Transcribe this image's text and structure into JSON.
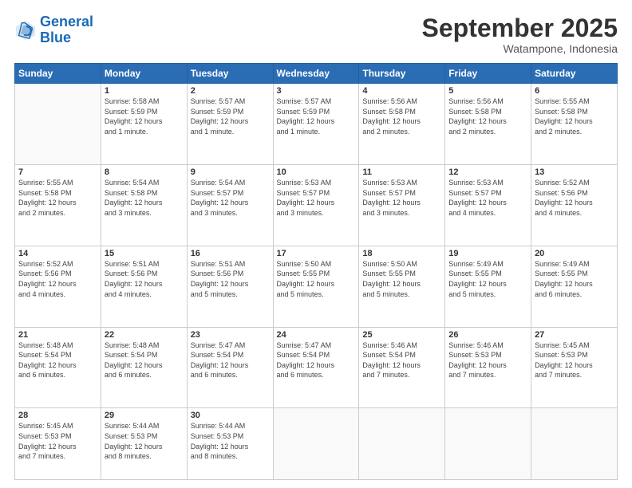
{
  "logo": {
    "line1": "General",
    "line2": "Blue"
  },
  "header": {
    "month": "September 2025",
    "location": "Watampone, Indonesia"
  },
  "weekdays": [
    "Sunday",
    "Monday",
    "Tuesday",
    "Wednesday",
    "Thursday",
    "Friday",
    "Saturday"
  ],
  "weeks": [
    [
      {
        "day": "",
        "info": ""
      },
      {
        "day": "1",
        "info": "Sunrise: 5:58 AM\nSunset: 5:59 PM\nDaylight: 12 hours\nand 1 minute."
      },
      {
        "day": "2",
        "info": "Sunrise: 5:57 AM\nSunset: 5:59 PM\nDaylight: 12 hours\nand 1 minute."
      },
      {
        "day": "3",
        "info": "Sunrise: 5:57 AM\nSunset: 5:59 PM\nDaylight: 12 hours\nand 1 minute."
      },
      {
        "day": "4",
        "info": "Sunrise: 5:56 AM\nSunset: 5:58 PM\nDaylight: 12 hours\nand 2 minutes."
      },
      {
        "day": "5",
        "info": "Sunrise: 5:56 AM\nSunset: 5:58 PM\nDaylight: 12 hours\nand 2 minutes."
      },
      {
        "day": "6",
        "info": "Sunrise: 5:55 AM\nSunset: 5:58 PM\nDaylight: 12 hours\nand 2 minutes."
      }
    ],
    [
      {
        "day": "7",
        "info": "Sunrise: 5:55 AM\nSunset: 5:58 PM\nDaylight: 12 hours\nand 2 minutes."
      },
      {
        "day": "8",
        "info": "Sunrise: 5:54 AM\nSunset: 5:58 PM\nDaylight: 12 hours\nand 3 minutes."
      },
      {
        "day": "9",
        "info": "Sunrise: 5:54 AM\nSunset: 5:57 PM\nDaylight: 12 hours\nand 3 minutes."
      },
      {
        "day": "10",
        "info": "Sunrise: 5:53 AM\nSunset: 5:57 PM\nDaylight: 12 hours\nand 3 minutes."
      },
      {
        "day": "11",
        "info": "Sunrise: 5:53 AM\nSunset: 5:57 PM\nDaylight: 12 hours\nand 3 minutes."
      },
      {
        "day": "12",
        "info": "Sunrise: 5:53 AM\nSunset: 5:57 PM\nDaylight: 12 hours\nand 4 minutes."
      },
      {
        "day": "13",
        "info": "Sunrise: 5:52 AM\nSunset: 5:56 PM\nDaylight: 12 hours\nand 4 minutes."
      }
    ],
    [
      {
        "day": "14",
        "info": "Sunrise: 5:52 AM\nSunset: 5:56 PM\nDaylight: 12 hours\nand 4 minutes."
      },
      {
        "day": "15",
        "info": "Sunrise: 5:51 AM\nSunset: 5:56 PM\nDaylight: 12 hours\nand 4 minutes."
      },
      {
        "day": "16",
        "info": "Sunrise: 5:51 AM\nSunset: 5:56 PM\nDaylight: 12 hours\nand 5 minutes."
      },
      {
        "day": "17",
        "info": "Sunrise: 5:50 AM\nSunset: 5:55 PM\nDaylight: 12 hours\nand 5 minutes."
      },
      {
        "day": "18",
        "info": "Sunrise: 5:50 AM\nSunset: 5:55 PM\nDaylight: 12 hours\nand 5 minutes."
      },
      {
        "day": "19",
        "info": "Sunrise: 5:49 AM\nSunset: 5:55 PM\nDaylight: 12 hours\nand 5 minutes."
      },
      {
        "day": "20",
        "info": "Sunrise: 5:49 AM\nSunset: 5:55 PM\nDaylight: 12 hours\nand 6 minutes."
      }
    ],
    [
      {
        "day": "21",
        "info": "Sunrise: 5:48 AM\nSunset: 5:54 PM\nDaylight: 12 hours\nand 6 minutes."
      },
      {
        "day": "22",
        "info": "Sunrise: 5:48 AM\nSunset: 5:54 PM\nDaylight: 12 hours\nand 6 minutes."
      },
      {
        "day": "23",
        "info": "Sunrise: 5:47 AM\nSunset: 5:54 PM\nDaylight: 12 hours\nand 6 minutes."
      },
      {
        "day": "24",
        "info": "Sunrise: 5:47 AM\nSunset: 5:54 PM\nDaylight: 12 hours\nand 6 minutes."
      },
      {
        "day": "25",
        "info": "Sunrise: 5:46 AM\nSunset: 5:54 PM\nDaylight: 12 hours\nand 7 minutes."
      },
      {
        "day": "26",
        "info": "Sunrise: 5:46 AM\nSunset: 5:53 PM\nDaylight: 12 hours\nand 7 minutes."
      },
      {
        "day": "27",
        "info": "Sunrise: 5:45 AM\nSunset: 5:53 PM\nDaylight: 12 hours\nand 7 minutes."
      }
    ],
    [
      {
        "day": "28",
        "info": "Sunrise: 5:45 AM\nSunset: 5:53 PM\nDaylight: 12 hours\nand 7 minutes."
      },
      {
        "day": "29",
        "info": "Sunrise: 5:44 AM\nSunset: 5:53 PM\nDaylight: 12 hours\nand 8 minutes."
      },
      {
        "day": "30",
        "info": "Sunrise: 5:44 AM\nSunset: 5:53 PM\nDaylight: 12 hours\nand 8 minutes."
      },
      {
        "day": "",
        "info": ""
      },
      {
        "day": "",
        "info": ""
      },
      {
        "day": "",
        "info": ""
      },
      {
        "day": "",
        "info": ""
      }
    ]
  ]
}
